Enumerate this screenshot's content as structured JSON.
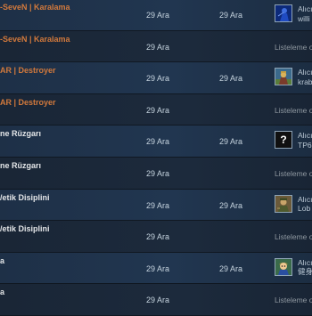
{
  "rows": [
    {
      "name": "-SeveN | Karalama",
      "color": "#d2793c",
      "date_listed": "29 Ara",
      "date_acted": "29 Ara",
      "type": "sale",
      "avatar_icon": "blue-character-avatar-icon",
      "buyer_line1": "Alıcı",
      "buyer_line2": "willi"
    },
    {
      "name": "-SeveN | Karalama",
      "color": "#d2793c",
      "date_listed": "29 Ara",
      "date_acted": "",
      "type": "listing",
      "status": "Listeleme o"
    },
    {
      "name": "AR | Destroyer",
      "color": "#d2793c",
      "date_listed": "29 Ara",
      "date_acted": "29 Ara",
      "type": "sale",
      "avatar_icon": "warrior-avatar-icon",
      "buyer_line1": "Alıcı",
      "buyer_line2": "krab"
    },
    {
      "name": "AR | Destroyer",
      "color": "#d2793c",
      "date_listed": "29 Ara",
      "date_acted": "",
      "type": "listing",
      "status": "Listeleme o"
    },
    {
      "name": "ne Rüzgarı",
      "color": "#e4e6e8",
      "date_listed": "29 Ara",
      "date_acted": "29 Ara",
      "type": "sale",
      "avatar_icon": "question-mark-avatar-icon",
      "avatar_glyph": "?",
      "buyer_line1": "Alıcı",
      "buyer_line2": "TP6"
    },
    {
      "name": "ne Rüzgarı",
      "color": "#e4e6e8",
      "date_listed": "29 Ara",
      "date_acted": "",
      "type": "listing",
      "status": "Listeleme o"
    },
    {
      "name": "/etik Disiplini",
      "color": "#e4e6e8",
      "date_listed": "29 Ara",
      "date_acted": "29 Ara",
      "type": "sale",
      "avatar_icon": "camo-soldier-avatar-icon",
      "buyer_line1": "Alıcı",
      "buyer_line2": "Lob"
    },
    {
      "name": "/etik Disiplini",
      "color": "#e4e6e8",
      "date_listed": "29 Ara",
      "date_acted": "",
      "type": "listing",
      "status": "Listeleme o"
    },
    {
      "name": "a",
      "color": "#e4e6e8",
      "date_listed": "29 Ara",
      "date_acted": "29 Ara",
      "type": "sale",
      "avatar_icon": "anime-character-avatar-icon",
      "buyer_line1": "Alıcı",
      "buyer_line2": "健身"
    },
    {
      "name": "a",
      "color": "#e4e6e8",
      "date_listed": "29 Ara",
      "date_acted": "",
      "type": "listing",
      "status": "Listeleme o"
    }
  ]
}
